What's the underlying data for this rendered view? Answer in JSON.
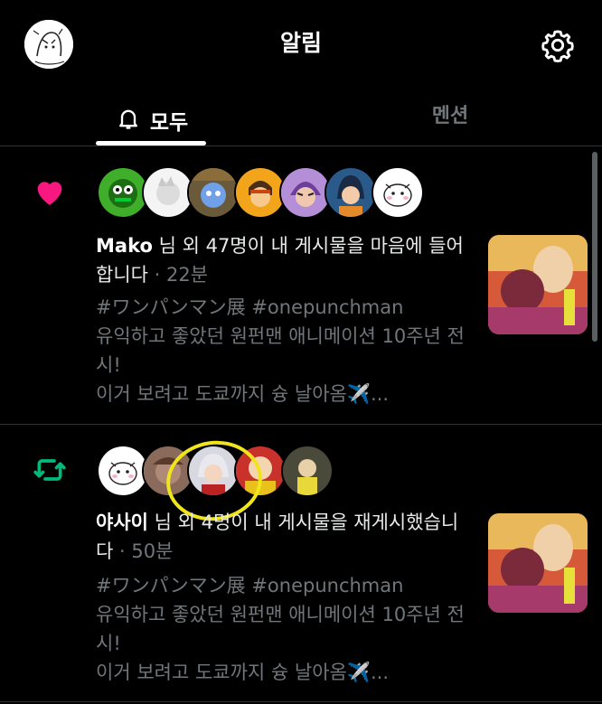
{
  "header": {
    "title": "알림",
    "settings_icon": "gear-icon"
  },
  "tabs": [
    {
      "label": "모두",
      "icon": "bell-icon",
      "active": true
    },
    {
      "label": "멘션",
      "active": false
    }
  ],
  "colors": {
    "like": "#f91880",
    "repost": "#00ba7c",
    "highlight": "#f0e51c"
  },
  "notifications": [
    {
      "type": "like",
      "icon": "heart-icon",
      "actor": "Mako",
      "summary": "님 외 47명이 내 게시물을 마음에 들어 합니다",
      "time": "22분",
      "post_text": "#ワンパンマン展 #onepunchman\n유익하고 좋았던 원펀맨 애니메이션 10주년 전시!\n이거 보려고 도쿄까지 슝 날아옴✈️...",
      "avatar_count": 7
    },
    {
      "type": "repost",
      "icon": "repost-icon",
      "actor": "야사이",
      "summary": "님 외 4명이 내 게시물을 재게시했습니다",
      "time": "50분",
      "post_text": "#ワンパンマン展 #onepunchman\n유익하고 좋았던 원펀맨 애니메이션 10주년 전시!\n이거 보려고 도쿄까지 슝 날아옴✈️...",
      "avatar_count": 5
    }
  ]
}
